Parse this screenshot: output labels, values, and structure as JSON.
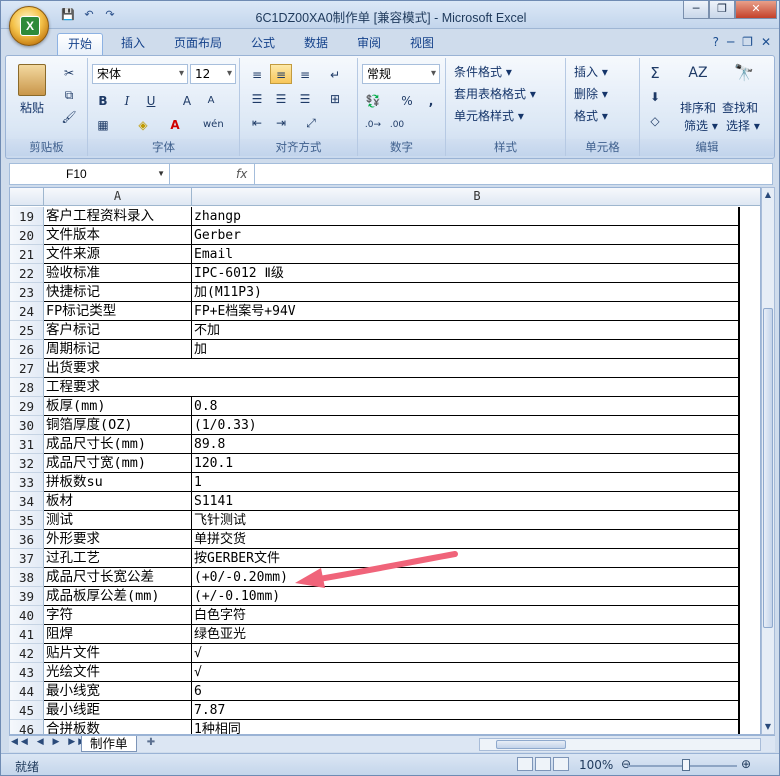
{
  "window": {
    "title": "6C1DZ00XA0制作单  [兼容模式] - Microsoft Excel",
    "controls": {
      "minimize": "─",
      "restore": "❐",
      "close": "✕"
    }
  },
  "qat": {
    "save_icon": "💾",
    "undo_icon": "↶",
    "redo_icon": "↷"
  },
  "tabs": [
    "开始",
    "插入",
    "页面布局",
    "公式",
    "数据",
    "审阅",
    "视图"
  ],
  "ribbon": {
    "clipboard": {
      "label": "剪贴板",
      "paste": "粘贴"
    },
    "font": {
      "label": "字体",
      "name": "宋体",
      "size": "12"
    },
    "alignment": {
      "label": "对齐方式"
    },
    "number": {
      "label": "数字",
      "format": "常规"
    },
    "styles": {
      "label": "样式",
      "cond": "条件格式 ▾",
      "table": "套用表格格式 ▾",
      "cell": "单元格样式 ▾"
    },
    "cells": {
      "label": "单元格",
      "insert": "插入 ▾",
      "delete": "删除 ▾",
      "format": "格式 ▾"
    },
    "editing": {
      "label": "编辑",
      "sort1": "排序和",
      "sort2": "筛选 ▾",
      "find1": "查找和",
      "find2": "选择 ▾"
    }
  },
  "formula_bar": {
    "cell_ref": "F10",
    "fx": "fx",
    "value": ""
  },
  "columns": [
    "A",
    "B"
  ],
  "rows": [
    {
      "n": "19",
      "a": "客户工程资料录入",
      "b": "zhangp"
    },
    {
      "n": "20",
      "a": "文件版本",
      "b": "Gerber"
    },
    {
      "n": "21",
      "a": "文件来源",
      "b": "Email"
    },
    {
      "n": "22",
      "a": "验收标准",
      "b": "IPC-6012 Ⅱ级"
    },
    {
      "n": "23",
      "a": "快捷标记",
      "b": "加(M11P3)"
    },
    {
      "n": "24",
      "a": "FP标记类型",
      "b": "FP+E档案号+94V"
    },
    {
      "n": "25",
      "a": "客户标记",
      "b": "不加"
    },
    {
      "n": "26",
      "a": "周期标记",
      "b": "加"
    },
    {
      "n": "27",
      "a": "出货要求",
      "b": "",
      "span": true
    },
    {
      "n": "28",
      "a": "工程要求",
      "b": "",
      "span": true
    },
    {
      "n": "29",
      "a": "板厚(mm)",
      "b": "0.8"
    },
    {
      "n": "30",
      "a": "铜箔厚度(OZ)",
      "b": " (1/0.33)"
    },
    {
      "n": "31",
      "a": "成品尺寸长(mm)",
      "b": "89.8"
    },
    {
      "n": "32",
      "a": "成品尺寸宽(mm)",
      "b": "120.1"
    },
    {
      "n": "33",
      "a": "拼板数su",
      "b": "1"
    },
    {
      "n": "34",
      "a": "板材",
      "b": "S1141"
    },
    {
      "n": "35",
      "a": "测试",
      "b": "飞针测试"
    },
    {
      "n": "36",
      "a": "外形要求",
      "b": "单拼交货"
    },
    {
      "n": "37",
      "a": "过孔工艺",
      "b": "按GERBER文件"
    },
    {
      "n": "38",
      "a": "成品尺寸长宽公差",
      "b": " (+0/-0.20mm)"
    },
    {
      "n": "39",
      "a": "成品板厚公差(mm)",
      "b": " (+/-0.10mm)"
    },
    {
      "n": "40",
      "a": "字符",
      "b": "白色字符"
    },
    {
      "n": "41",
      "a": "阻焊",
      "b": "绿色亚光"
    },
    {
      "n": "42",
      "a": "贴片文件",
      "b": " √"
    },
    {
      "n": "43",
      "a": "光绘文件",
      "b": " √"
    },
    {
      "n": "44",
      "a": "最小线宽",
      "b": "6"
    },
    {
      "n": "45",
      "a": "最小线距",
      "b": "7.87"
    },
    {
      "n": "46",
      "a": "合拼板数",
      "b": "1种相同"
    }
  ],
  "sheet_tabs": [
    "制作单"
  ],
  "status": {
    "text": "就绪",
    "zoom": "100%"
  },
  "colors": {
    "annotation_arrow": "#f0647a"
  }
}
